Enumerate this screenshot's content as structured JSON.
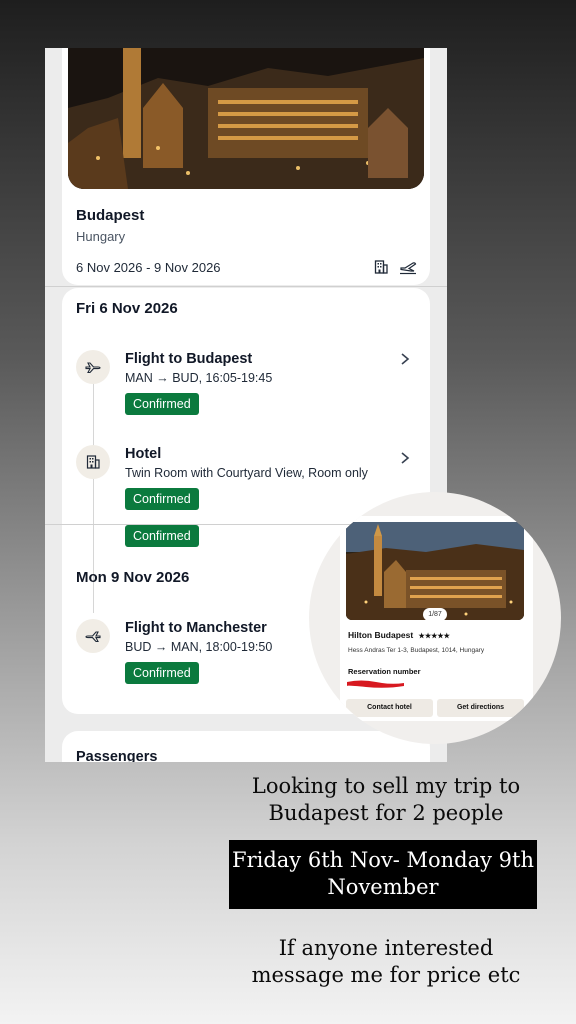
{
  "trip": {
    "destination": "Budapest",
    "country": "Hungary",
    "dates": "6 Nov 2026 - 9 Nov 2026",
    "icons": [
      "building-icon",
      "plane-icon"
    ]
  },
  "days": [
    {
      "title": "Fri 6 Nov 2026",
      "items": [
        {
          "icon": "plane-icon",
          "title": "Flight to Budapest",
          "subtitle": "MAN → BUD, 16:05-19:45",
          "status": "Confirmed"
        },
        {
          "icon": "building-icon",
          "title": "Hotel",
          "subtitle": "Twin Room with Courtyard View, Room only",
          "status": "Confirmed"
        }
      ],
      "extra_status": "Confirmed"
    },
    {
      "title": "Mon 9 Nov 2026",
      "items": [
        {
          "icon": "plane-icon",
          "title": "Flight to Manchester",
          "subtitle": "BUD → MAN, 18:00-19:50",
          "status": "Confirmed"
        }
      ]
    }
  ],
  "passengers": {
    "title": "Passengers"
  },
  "hotel_inset": {
    "photo_counter": "1/87",
    "name": "Hilton Budapest",
    "stars": "★★★★★",
    "address": "Hess Andras Ter 1-3, Budapest, 1014, Hungary",
    "reservation_label": "Reservation number",
    "contact_button": "Contact hotel",
    "directions_button": "Get directions"
  },
  "captions": {
    "line1": "Looking to sell my trip to Budapest for 2 people",
    "highlight": "Friday 6th Nov- Monday 9th November",
    "line3": "If anyone interested message me for price etc"
  },
  "colors": {
    "confirmed_badge": "#0b7a3e",
    "redaction": "#d71920"
  }
}
